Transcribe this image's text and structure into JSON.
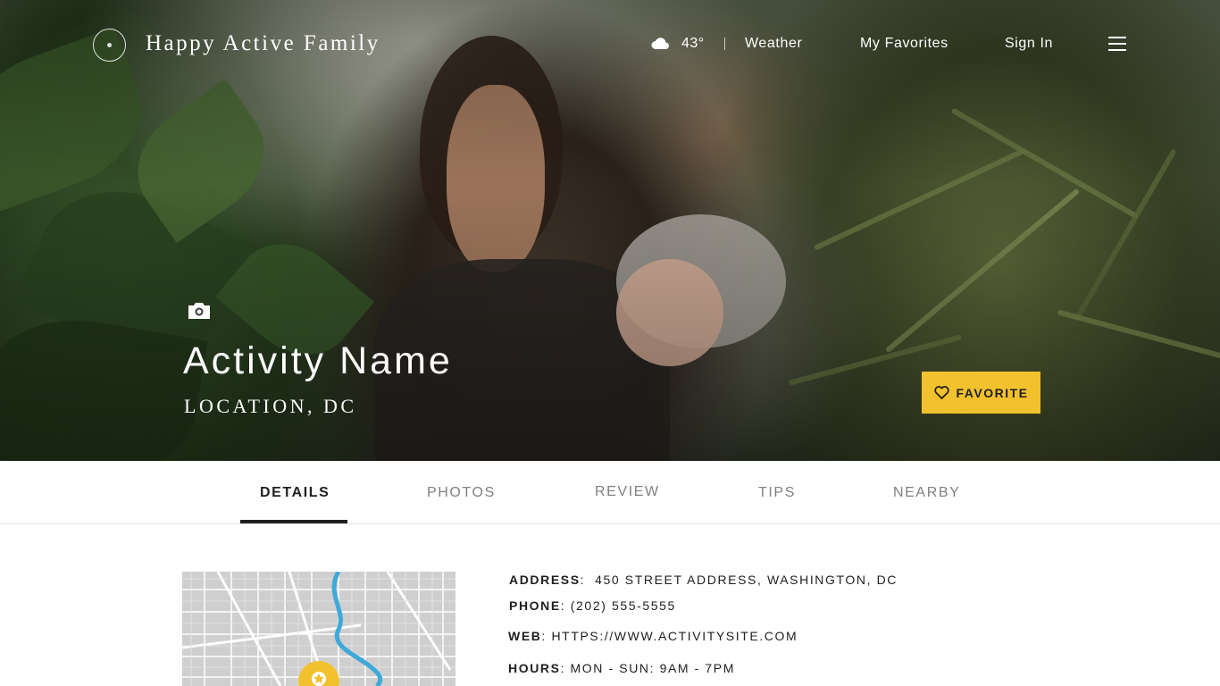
{
  "brand": {
    "name": "Happy Active Family"
  },
  "header": {
    "weather_icon": "cloud-icon",
    "temperature": "43°",
    "nav": [
      "Weather",
      "My Favorites",
      "Sign In"
    ],
    "menu_icon": "hamburger-menu-icon"
  },
  "hero": {
    "camera_icon": "camera-icon",
    "title": "Activity Name",
    "location": "LOCATION, DC",
    "favorite_label": "FAVORITE",
    "favorite_icon": "heart-icon",
    "accent_color": "#f2c12e"
  },
  "tabs": {
    "items": [
      "DETAILS",
      "PHOTOS",
      "REVIEW",
      "TIPS",
      "NEARBY"
    ],
    "active": "DETAILS"
  },
  "details": {
    "address_label": "ADDRESS",
    "address_value": "450 STREET ADDRESS, WASHINGTON, DC",
    "phone_label": "PHONE",
    "phone_value": "(202) 555-5555",
    "web_label": "WEB",
    "web_value": "HTTPS://WWW.ACTIVITYSITE.COM",
    "hours_label": "HOURS",
    "hours_value": "MON - SUN: 9AM - 7PM"
  },
  "map": {
    "marker_icon": "star-map-marker-icon",
    "river_color": "#3fa9d8"
  }
}
